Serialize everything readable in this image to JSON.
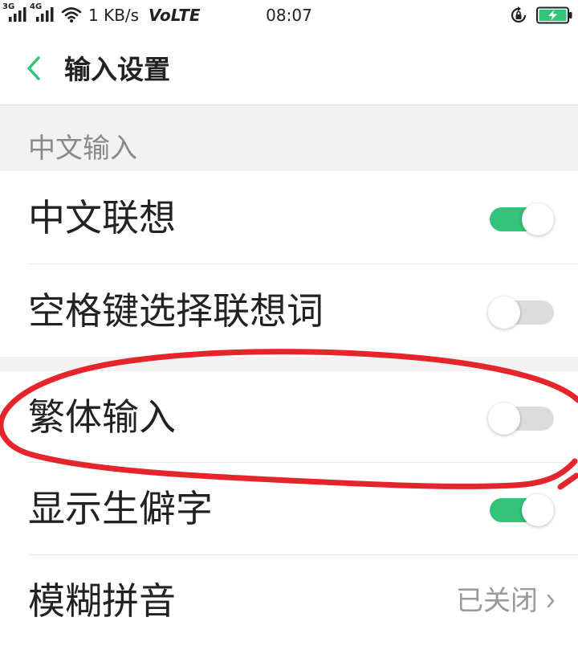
{
  "status_bar": {
    "network_1": "3G",
    "network_2": "4G",
    "speed": "1 KB/s",
    "volte": "VoLTE",
    "time": "08:07",
    "icons": [
      "signal-icon",
      "signal-icon",
      "wifi-icon",
      "rotation-lock-icon",
      "battery-charging-icon"
    ],
    "battery": {
      "level": 1.0,
      "charging": true
    }
  },
  "header": {
    "title": "输入设置",
    "back_icon": "chevron-left-icon"
  },
  "settings": {
    "section_label": "中文输入",
    "rows": [
      {
        "label": "中文联想",
        "on": true
      },
      {
        "label": "空格键选择联想词",
        "on": false
      },
      {
        "label": "繁体输入",
        "on": false
      },
      {
        "label": "显示生僻字",
        "on": true
      },
      {
        "label": "模糊拼音",
        "value": "已关闭",
        "trailing_icon": "chevron-right-icon"
      }
    ]
  },
  "colors": {
    "accent": "#35c27a",
    "toggle_off": "#dcdcdc",
    "section_background": "#f2f2f3",
    "annotation": "#e4262c"
  }
}
